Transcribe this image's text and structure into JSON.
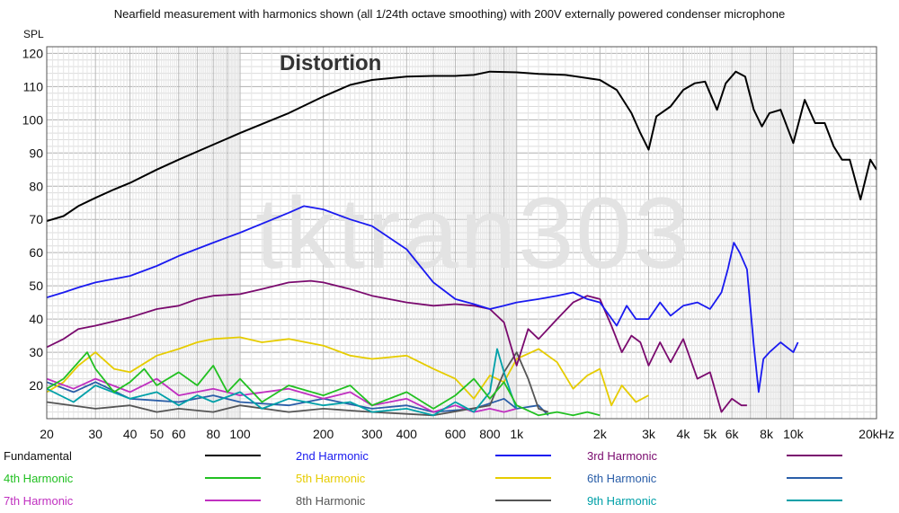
{
  "chart_data": {
    "type": "line",
    "title": "Nearfield measurement with harmonics shown (all 1/24th octave smoothing) with 200V externally powered condenser microphone",
    "ylabel": "SPL",
    "xlabel": "",
    "x_scale": "log",
    "xlim": [
      20,
      20000
    ],
    "ylim": [
      10,
      122
    ],
    "grid": true,
    "legend_position": "bottom",
    "annotation": "Distortion",
    "watermark": "tktran303",
    "x_ticks": [
      {
        "value": 20,
        "label": "20"
      },
      {
        "value": 30,
        "label": "30"
      },
      {
        "value": 40,
        "label": "40"
      },
      {
        "value": 50,
        "label": "50"
      },
      {
        "value": 60,
        "label": "60"
      },
      {
        "value": 80,
        "label": "80"
      },
      {
        "value": 100,
        "label": "100"
      },
      {
        "value": 200,
        "label": "200"
      },
      {
        "value": 300,
        "label": "300"
      },
      {
        "value": 400,
        "label": "400"
      },
      {
        "value": 600,
        "label": "600"
      },
      {
        "value": 800,
        "label": "800"
      },
      {
        "value": 1000,
        "label": "1k"
      },
      {
        "value": 2000,
        "label": "2k"
      },
      {
        "value": 3000,
        "label": "3k"
      },
      {
        "value": 4000,
        "label": "4k"
      },
      {
        "value": 5000,
        "label": "5k"
      },
      {
        "value": 6000,
        "label": "6k"
      },
      {
        "value": 8000,
        "label": "8k"
      },
      {
        "value": 10000,
        "label": "10k"
      },
      {
        "value": 20000,
        "label": "20kHz"
      }
    ],
    "y_ticks": [
      {
        "value": 20,
        "label": "20"
      },
      {
        "value": 30,
        "label": "30"
      },
      {
        "value": 40,
        "label": "40"
      },
      {
        "value": 50,
        "label": "50"
      },
      {
        "value": 60,
        "label": "60"
      },
      {
        "value": 70,
        "label": "70"
      },
      {
        "value": 80,
        "label": "80"
      },
      {
        "value": 90,
        "label": "90"
      },
      {
        "value": 100,
        "label": "100"
      },
      {
        "value": 110,
        "label": "110"
      },
      {
        "value": 120,
        "label": "120"
      }
    ],
    "series": [
      {
        "name": "Fundamental",
        "color": "#000000",
        "points": [
          [
            20,
            69.5
          ],
          [
            23,
            71
          ],
          [
            26,
            74
          ],
          [
            30,
            76.5
          ],
          [
            35,
            79
          ],
          [
            40,
            81
          ],
          [
            50,
            85
          ],
          [
            60,
            88
          ],
          [
            80,
            92.5
          ],
          [
            100,
            96
          ],
          [
            150,
            102
          ],
          [
            200,
            107
          ],
          [
            250,
            110.5
          ],
          [
            300,
            112
          ],
          [
            400,
            113
          ],
          [
            500,
            113.2
          ],
          [
            600,
            113.2
          ],
          [
            700,
            113.5
          ],
          [
            800,
            114.5
          ],
          [
            1000,
            114.3
          ],
          [
            1200,
            113.8
          ],
          [
            1500,
            113.5
          ],
          [
            2000,
            112
          ],
          [
            2300,
            109
          ],
          [
            2600,
            102
          ],
          [
            2800,
            96
          ],
          [
            3000,
            91
          ],
          [
            3200,
            101
          ],
          [
            3600,
            104
          ],
          [
            4000,
            109
          ],
          [
            4400,
            111
          ],
          [
            4800,
            111.5
          ],
          [
            5000,
            108
          ],
          [
            5300,
            103
          ],
          [
            5700,
            111
          ],
          [
            6200,
            114.5
          ],
          [
            6700,
            113
          ],
          [
            7200,
            103
          ],
          [
            7700,
            98
          ],
          [
            8200,
            102
          ],
          [
            9000,
            103
          ],
          [
            10000,
            93
          ],
          [
            11000,
            106
          ],
          [
            12000,
            99
          ],
          [
            13000,
            99
          ],
          [
            14000,
            92
          ],
          [
            15000,
            88
          ],
          [
            16000,
            88
          ],
          [
            17500,
            76
          ],
          [
            19000,
            88
          ],
          [
            20000,
            85
          ]
        ]
      },
      {
        "name": "2nd Harmonic",
        "color": "#1a1af0",
        "points": [
          [
            20,
            46.5
          ],
          [
            23,
            48
          ],
          [
            26,
            49.5
          ],
          [
            30,
            51
          ],
          [
            40,
            53
          ],
          [
            50,
            56
          ],
          [
            60,
            59
          ],
          [
            80,
            63
          ],
          [
            100,
            66
          ],
          [
            150,
            72
          ],
          [
            170,
            74
          ],
          [
            200,
            73
          ],
          [
            250,
            70
          ],
          [
            300,
            68
          ],
          [
            400,
            61
          ],
          [
            500,
            51
          ],
          [
            600,
            46
          ],
          [
            700,
            44.5
          ],
          [
            800,
            43
          ],
          [
            900,
            44
          ],
          [
            1000,
            45
          ],
          [
            1200,
            46
          ],
          [
            1400,
            47
          ],
          [
            1600,
            48
          ],
          [
            1800,
            46
          ],
          [
            2000,
            45
          ],
          [
            2300,
            38
          ],
          [
            2500,
            44
          ],
          [
            2700,
            40
          ],
          [
            3000,
            40
          ],
          [
            3300,
            45
          ],
          [
            3600,
            41
          ],
          [
            4000,
            44
          ],
          [
            4500,
            45
          ],
          [
            5000,
            43
          ],
          [
            5500,
            48
          ],
          [
            5800,
            55
          ],
          [
            6100,
            63
          ],
          [
            6400,
            60
          ],
          [
            6800,
            55
          ],
          [
            7200,
            32
          ],
          [
            7500,
            18
          ],
          [
            7800,
            28
          ],
          [
            8200,
            30
          ],
          [
            9000,
            33
          ],
          [
            10000,
            30
          ],
          [
            10400,
            33
          ]
        ]
      },
      {
        "name": "3rd Harmonic",
        "color": "#7a0a6e",
        "points": [
          [
            20,
            31.5
          ],
          [
            23,
            34
          ],
          [
            26,
            37
          ],
          [
            30,
            38
          ],
          [
            40,
            40.5
          ],
          [
            50,
            43
          ],
          [
            60,
            44
          ],
          [
            70,
            46
          ],
          [
            80,
            47
          ],
          [
            100,
            47.5
          ],
          [
            120,
            49
          ],
          [
            150,
            51
          ],
          [
            180,
            51.5
          ],
          [
            200,
            51
          ],
          [
            250,
            49
          ],
          [
            300,
            47
          ],
          [
            400,
            45
          ],
          [
            500,
            44
          ],
          [
            600,
            44.5
          ],
          [
            700,
            44
          ],
          [
            800,
            43
          ],
          [
            900,
            39
          ],
          [
            1000,
            26
          ],
          [
            1100,
            37
          ],
          [
            1200,
            34
          ],
          [
            1400,
            40
          ],
          [
            1600,
            45
          ],
          [
            1800,
            47
          ],
          [
            2000,
            46
          ],
          [
            2200,
            38
          ],
          [
            2400,
            30
          ],
          [
            2600,
            35
          ],
          [
            2800,
            33
          ],
          [
            3000,
            26
          ],
          [
            3300,
            33
          ],
          [
            3600,
            27
          ],
          [
            4000,
            34
          ],
          [
            4500,
            22
          ],
          [
            5000,
            24
          ],
          [
            5500,
            12
          ],
          [
            6000,
            16
          ],
          [
            6500,
            14
          ],
          [
            6800,
            14
          ]
        ]
      },
      {
        "name": "4th Harmonic",
        "color": "#22c022",
        "points": [
          [
            20,
            19
          ],
          [
            23,
            22
          ],
          [
            26,
            27
          ],
          [
            28,
            30
          ],
          [
            30,
            25
          ],
          [
            35,
            18
          ],
          [
            40,
            21
          ],
          [
            45,
            25
          ],
          [
            50,
            20
          ],
          [
            60,
            24
          ],
          [
            70,
            20
          ],
          [
            80,
            26
          ],
          [
            90,
            18
          ],
          [
            100,
            22
          ],
          [
            120,
            15
          ],
          [
            150,
            20
          ],
          [
            200,
            17
          ],
          [
            250,
            20
          ],
          [
            300,
            14
          ],
          [
            400,
            18
          ],
          [
            500,
            13
          ],
          [
            600,
            17
          ],
          [
            700,
            22
          ],
          [
            800,
            16
          ],
          [
            900,
            21
          ],
          [
            1000,
            14
          ],
          [
            1200,
            11
          ],
          [
            1400,
            12
          ],
          [
            1600,
            11
          ],
          [
            1800,
            12
          ],
          [
            2000,
            11
          ]
        ]
      },
      {
        "name": "5th Harmonic",
        "color": "#e6cc00",
        "points": [
          [
            20,
            18
          ],
          [
            23,
            21
          ],
          [
            26,
            26
          ],
          [
            30,
            30
          ],
          [
            35,
            25
          ],
          [
            40,
            24
          ],
          [
            50,
            29
          ],
          [
            60,
            31
          ],
          [
            70,
            33
          ],
          [
            80,
            34
          ],
          [
            100,
            34.5
          ],
          [
            120,
            33
          ],
          [
            150,
            34
          ],
          [
            200,
            32
          ],
          [
            250,
            29
          ],
          [
            300,
            28
          ],
          [
            400,
            29
          ],
          [
            500,
            25
          ],
          [
            600,
            22
          ],
          [
            700,
            16
          ],
          [
            800,
            23
          ],
          [
            900,
            21
          ],
          [
            1000,
            28
          ],
          [
            1200,
            31
          ],
          [
            1400,
            27
          ],
          [
            1600,
            19
          ],
          [
            1800,
            23
          ],
          [
            2000,
            25
          ],
          [
            2200,
            14
          ],
          [
            2400,
            20
          ],
          [
            2700,
            15
          ],
          [
            3000,
            17
          ]
        ]
      },
      {
        "name": "6th Harmonic",
        "color": "#2a5ea8",
        "points": [
          [
            20,
            21
          ],
          [
            25,
            18
          ],
          [
            30,
            21
          ],
          [
            40,
            16
          ],
          [
            60,
            15
          ],
          [
            80,
            17
          ],
          [
            100,
            15
          ],
          [
            150,
            14
          ],
          [
            200,
            16
          ],
          [
            300,
            13
          ],
          [
            400,
            14
          ],
          [
            500,
            12
          ],
          [
            700,
            13
          ],
          [
            900,
            16
          ],
          [
            1000,
            13
          ],
          [
            1200,
            14
          ],
          [
            1300,
            11
          ]
        ]
      },
      {
        "name": "7th Harmonic",
        "color": "#c030c0",
        "points": [
          [
            20,
            22
          ],
          [
            25,
            19
          ],
          [
            30,
            22
          ],
          [
            40,
            18
          ],
          [
            50,
            22
          ],
          [
            60,
            17
          ],
          [
            80,
            19
          ],
          [
            100,
            17
          ],
          [
            150,
            19
          ],
          [
            200,
            16
          ],
          [
            250,
            18
          ],
          [
            300,
            14
          ],
          [
            400,
            16
          ],
          [
            500,
            12
          ],
          [
            600,
            14
          ],
          [
            700,
            12
          ],
          [
            800,
            13
          ],
          [
            900,
            12
          ],
          [
            1000,
            13
          ]
        ]
      },
      {
        "name": "8th Harmonic",
        "color": "#555555",
        "points": [
          [
            20,
            15
          ],
          [
            30,
            13
          ],
          [
            40,
            14
          ],
          [
            50,
            12
          ],
          [
            60,
            13
          ],
          [
            80,
            12
          ],
          [
            100,
            14
          ],
          [
            150,
            12
          ],
          [
            200,
            13
          ],
          [
            300,
            12
          ],
          [
            500,
            11
          ],
          [
            800,
            14
          ],
          [
            900,
            24
          ],
          [
            1000,
            30
          ],
          [
            1100,
            22
          ],
          [
            1200,
            13
          ],
          [
            1300,
            12
          ]
        ]
      },
      {
        "name": "9th Harmonic",
        "color": "#00a0a8",
        "points": [
          [
            20,
            19
          ],
          [
            25,
            15
          ],
          [
            30,
            20
          ],
          [
            40,
            16
          ],
          [
            50,
            18
          ],
          [
            60,
            14
          ],
          [
            70,
            17
          ],
          [
            80,
            15
          ],
          [
            100,
            18
          ],
          [
            120,
            13
          ],
          [
            150,
            16
          ],
          [
            200,
            14
          ],
          [
            250,
            15
          ],
          [
            300,
            12
          ],
          [
            400,
            13
          ],
          [
            500,
            11
          ],
          [
            600,
            15
          ],
          [
            700,
            12
          ],
          [
            800,
            18
          ],
          [
            850,
            31
          ],
          [
            900,
            24
          ],
          [
            950,
            18
          ],
          [
            1000,
            13
          ]
        ]
      }
    ]
  }
}
